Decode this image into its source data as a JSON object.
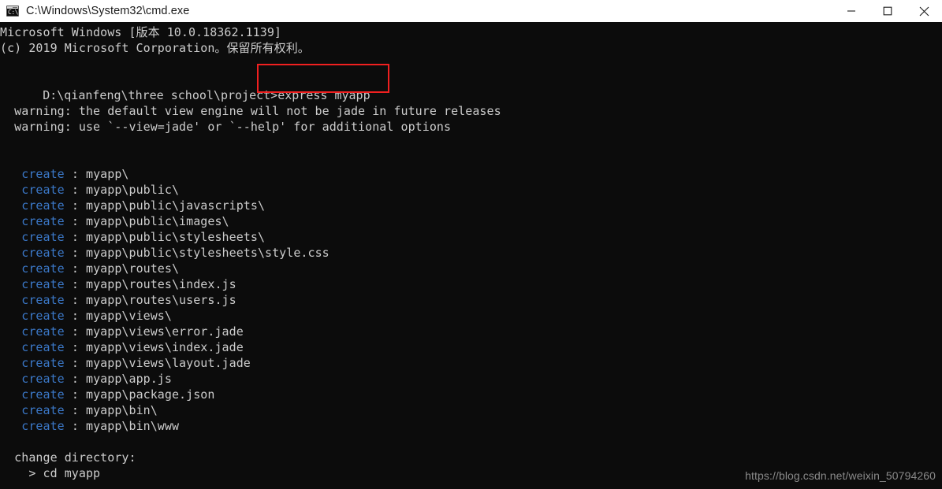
{
  "window": {
    "title": "C:\\Windows\\System32\\cmd.exe",
    "icon_name": "cmd-icon",
    "icon_text": "C:\\",
    "titlebar_bg": "#ffffff",
    "console_bg": "#0c0c0c",
    "controls": [
      {
        "name": "minimize-button",
        "glyph": "minimize"
      },
      {
        "name": "maximize-button",
        "glyph": "maximize"
      },
      {
        "name": "close-button",
        "glyph": "close"
      }
    ]
  },
  "colors": {
    "text": "#cccccc",
    "create_keyword": "#3b78c8",
    "highlight_box": "#f02020",
    "watermark": "#8a8a8a"
  },
  "console": {
    "banner": [
      "Microsoft Windows [版本 10.0.18362.1139]",
      "(c) 2019 Microsoft Corporation。保留所有权利。"
    ],
    "prompt": "D:\\qianfeng\\three school\\project>",
    "command": "express myapp",
    "warnings": [
      "  warning: the default view engine will not be jade in future releases",
      "  warning: use `--view=jade' or `--help' for additional options"
    ],
    "create_label": "create",
    "create_separator": " : ",
    "create_indent": "   ",
    "created_paths": [
      "myapp\\",
      "myapp\\public\\",
      "myapp\\public\\javascripts\\",
      "myapp\\public\\images\\",
      "myapp\\public\\stylesheets\\",
      "myapp\\public\\stylesheets\\style.css",
      "myapp\\routes\\",
      "myapp\\routes\\index.js",
      "myapp\\routes\\users.js",
      "myapp\\views\\",
      "myapp\\views\\error.jade",
      "myapp\\views\\index.jade",
      "myapp\\views\\layout.jade",
      "myapp\\app.js",
      "myapp\\package.json",
      "myapp\\bin\\",
      "myapp\\bin\\www"
    ],
    "footer": [
      "  change directory:",
      "    > cd myapp"
    ]
  },
  "watermark": "https://blog.csdn.net/weixin_50794260"
}
